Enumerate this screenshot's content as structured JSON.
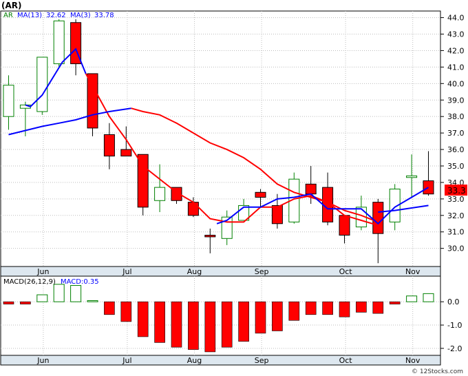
{
  "ticker_label": "(AR)",
  "credit": "© 12Stocks.com",
  "price_panel": {
    "legend": {
      "symbol": "AR",
      "ma13_label": "MA(13)",
      "ma13_value": "32.62",
      "ma3_label": "MA(3)",
      "ma3_value": "33.78"
    },
    "last_price_label": "33.3"
  },
  "macd_panel": {
    "legend": {
      "title": "MACD(26,12,9)",
      "value_label": "MACD:0.35"
    }
  },
  "colors": {
    "up": "#008000",
    "down": "#ff0000",
    "ma3": "#ff0000",
    "ma13": "#0000ff",
    "panel": "#ffffff",
    "axis_band": "#dde7ef",
    "grid": "#bdbdbd"
  },
  "chart_data": [
    {
      "type": "candlestick",
      "y_ticks": [
        "30.0",
        "31.0",
        "32.0",
        "33.0",
        "34.0",
        "35.0",
        "36.0",
        "37.0",
        "38.0",
        "39.0",
        "40.0",
        "41.0",
        "42.0",
        "43.0",
        "44.0"
      ],
      "ylim": [
        28.9,
        44.4
      ],
      "x_ticks": [
        {
          "label": "Jun",
          "index": 1
        },
        {
          "label": "Jul",
          "index": 6
        },
        {
          "label": "Aug",
          "index": 10
        },
        {
          "label": "Sep",
          "index": 14
        },
        {
          "label": "Oct",
          "index": 19
        },
        {
          "label": "Nov",
          "index": 23
        }
      ],
      "candles": [
        {
          "o": 38.0,
          "h": 40.5,
          "l": 37.2,
          "c": 39.9
        },
        {
          "o": 38.5,
          "h": 38.9,
          "l": 36.8,
          "c": 38.7
        },
        {
          "o": 38.3,
          "h": 41.6,
          "l": 38.1,
          "c": 41.6
        },
        {
          "o": 41.2,
          "h": 43.9,
          "l": 41.0,
          "c": 43.8
        },
        {
          "o": 43.7,
          "h": 43.9,
          "l": 40.5,
          "c": 41.2
        },
        {
          "o": 40.6,
          "h": 40.6,
          "l": 36.8,
          "c": 37.3
        },
        {
          "o": 36.9,
          "h": 37.6,
          "l": 34.8,
          "c": 35.6
        },
        {
          "o": 36.0,
          "h": 37.4,
          "l": 35.6,
          "c": 35.6
        },
        {
          "o": 35.7,
          "h": 35.7,
          "l": 32.0,
          "c": 32.5
        },
        {
          "o": 32.9,
          "h": 35.1,
          "l": 32.2,
          "c": 33.7
        },
        {
          "o": 33.7,
          "h": 33.7,
          "l": 32.7,
          "c": 32.9
        },
        {
          "o": 32.8,
          "h": 33.1,
          "l": 31.9,
          "c": 32.0
        },
        {
          "o": 30.8,
          "h": 31.2,
          "l": 29.7,
          "c": 30.7
        },
        {
          "o": 30.6,
          "h": 32.3,
          "l": 30.2,
          "c": 31.9
        },
        {
          "o": 31.7,
          "h": 33.0,
          "l": 31.7,
          "c": 32.6
        },
        {
          "o": 33.4,
          "h": 33.6,
          "l": 32.5,
          "c": 33.1
        },
        {
          "o": 32.6,
          "h": 33.3,
          "l": 31.2,
          "c": 31.5
        },
        {
          "o": 31.6,
          "h": 34.6,
          "l": 31.5,
          "c": 34.2
        },
        {
          "o": 33.9,
          "h": 35.0,
          "l": 32.7,
          "c": 33.3
        },
        {
          "o": 33.7,
          "h": 34.6,
          "l": 31.4,
          "c": 31.6
        },
        {
          "o": 32.0,
          "h": 32.0,
          "l": 30.3,
          "c": 30.8
        },
        {
          "o": 31.3,
          "h": 33.2,
          "l": 31.1,
          "c": 32.5
        },
        {
          "o": 32.8,
          "h": 33.0,
          "l": 29.1,
          "c": 30.9
        },
        {
          "o": 31.6,
          "h": 33.9,
          "l": 31.1,
          "c": 33.6
        },
        {
          "o": 34.3,
          "h": 35.7,
          "l": 33.1,
          "c": 34.4
        },
        {
          "o": 34.1,
          "h": 35.9,
          "l": 33.2,
          "c": 33.3
        }
      ],
      "series": [
        {
          "key": "ma3",
          "values": [
            null,
            null,
            38.8,
            39.3,
            41.3,
            42.1,
            40.6,
            38.0,
            null,
            null,
            null,
            null,
            null,
            null,
            null,
            null,
            null,
            null,
            null,
            null,
            null,
            null,
            null,
            null,
            null,
            null
          ],
          "points": [
            [
              1.0,
              38.7
            ],
            [
              1.3,
              38.6
            ],
            [
              2.0,
              39.3
            ],
            [
              3.2,
              41.3
            ],
            [
              4.0,
              42.1
            ],
            [
              4.6,
              40.6
            ],
            [
              6.0,
              38.0
            ],
            [
              7.0,
              36.6
            ],
            [
              8.0,
              35.0
            ],
            [
              9.0,
              34.2
            ],
            [
              10.0,
              33.4
            ],
            [
              11.0,
              32.8
            ],
            [
              12.0,
              31.8
            ],
            [
              13.0,
              31.6
            ],
            [
              14.0,
              31.6
            ],
            [
              15.0,
              32.5
            ],
            [
              16.0,
              32.5
            ],
            [
              17.0,
              33.0
            ],
            [
              18.0,
              33.2
            ],
            [
              19.0,
              32.8
            ],
            [
              20.0,
              32.0
            ],
            [
              21.0,
              31.7
            ],
            [
              22.0,
              31.4
            ]
          ]
        },
        {
          "key": "ma13",
          "points": [
            [
              0.0,
              36.9
            ],
            [
              2.0,
              37.4
            ],
            [
              3.0,
              37.6
            ],
            [
              4.0,
              37.8
            ],
            [
              5.0,
              38.1
            ],
            [
              6.0,
              38.3
            ],
            [
              7.3,
              38.5
            ]
          ]
        },
        {
          "key": "ma13b",
          "points": [
            [
              7.3,
              38.5
            ],
            [
              8.0,
              38.3
            ],
            [
              9.0,
              38.1
            ],
            [
              10.0,
              37.6
            ],
            [
              11.0,
              37.0
            ],
            [
              12.0,
              36.4
            ],
            [
              13.0,
              36.0
            ],
            [
              14.0,
              35.5
            ],
            [
              15.0,
              34.8
            ],
            [
              16.0,
              33.9
            ],
            [
              17.0,
              33.4
            ],
            [
              18.0,
              33.1
            ],
            [
              19.0,
              32.8
            ],
            [
              20.0,
              32.3
            ],
            [
              21.0,
              32.0
            ],
            [
              22.0,
              31.6
            ]
          ]
        },
        {
          "key": "ma3_recent",
          "points": [
            [
              12.4,
              31.5
            ],
            [
              13.0,
              31.7
            ],
            [
              14.0,
              32.5
            ],
            [
              15.0,
              32.5
            ],
            [
              16.0,
              33.0
            ],
            [
              17.0,
              33.1
            ],
            [
              18.0,
              33.3
            ],
            [
              19.0,
              32.4
            ],
            [
              20.0,
              32.4
            ],
            [
              21.0,
              32.4
            ],
            [
              22.0,
              31.5
            ],
            [
              23.0,
              32.5
            ],
            [
              24.0,
              33.1
            ],
            [
              25.0,
              33.7
            ]
          ]
        },
        {
          "key": "ma13_recent",
          "points": [
            [
              22.0,
              32.2
            ],
            [
              23.0,
              32.3
            ],
            [
              25.0,
              32.6
            ]
          ]
        }
      ]
    },
    {
      "type": "bar",
      "title": "MACD(26,12,9)",
      "y_ticks": [
        "0.0",
        "-1.0",
        "-2.0"
      ],
      "ylim": [
        -2.3,
        1.1
      ],
      "values": [
        -0.1,
        -0.1,
        0.3,
        0.75,
        0.7,
        0.05,
        -0.55,
        -0.85,
        -1.5,
        -1.75,
        -1.95,
        -2.05,
        -2.15,
        -1.95,
        -1.7,
        -1.35,
        -1.25,
        -0.8,
        -0.55,
        -0.55,
        -0.65,
        -0.45,
        -0.5,
        -0.1,
        0.25,
        0.35
      ]
    }
  ]
}
